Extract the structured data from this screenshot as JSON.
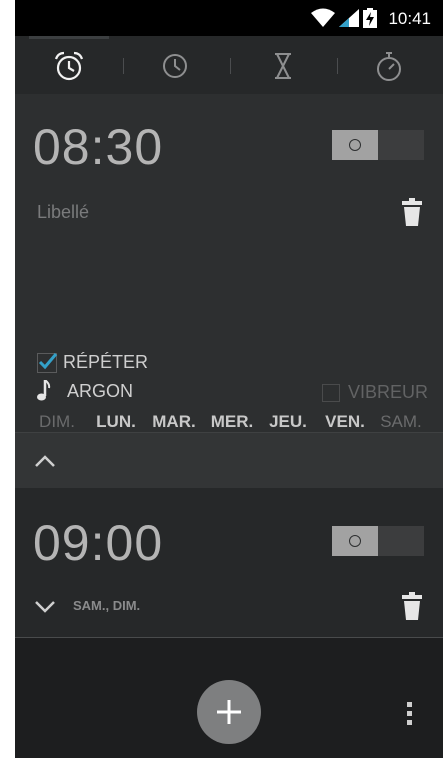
{
  "status_bar": {
    "time": "10:41"
  },
  "tabs": [
    {
      "name": "alarm",
      "icon": "alarm-clock-icon",
      "active": true
    },
    {
      "name": "clock",
      "icon": "clock-icon",
      "active": false
    },
    {
      "name": "timer",
      "icon": "hourglass-icon",
      "active": false
    },
    {
      "name": "stopwatch",
      "icon": "stopwatch-icon",
      "active": false
    }
  ],
  "alarm1": {
    "time": "08:30",
    "enabled": false,
    "label_placeholder": "Libellé",
    "repeat_label": "RÉPÉTER",
    "repeat_checked": true,
    "days": [
      {
        "label": "DIM.",
        "on": false
      },
      {
        "label": "LUN.",
        "on": true
      },
      {
        "label": "MAR.",
        "on": true
      },
      {
        "label": "MER.",
        "on": true
      },
      {
        "label": "JEU.",
        "on": true
      },
      {
        "label": "VEN.",
        "on": true
      },
      {
        "label": "SAM.",
        "on": false
      }
    ],
    "ringtone": "ARGON",
    "vibrate_label": "VIBREUR",
    "vibrate_checked": false
  },
  "alarm2": {
    "time": "09:00",
    "enabled": false,
    "schedule": "SAM., DIM."
  },
  "colors": {
    "accent": "#33a0c8",
    "background": "#1d1e1f",
    "card": "#2d2f30"
  }
}
